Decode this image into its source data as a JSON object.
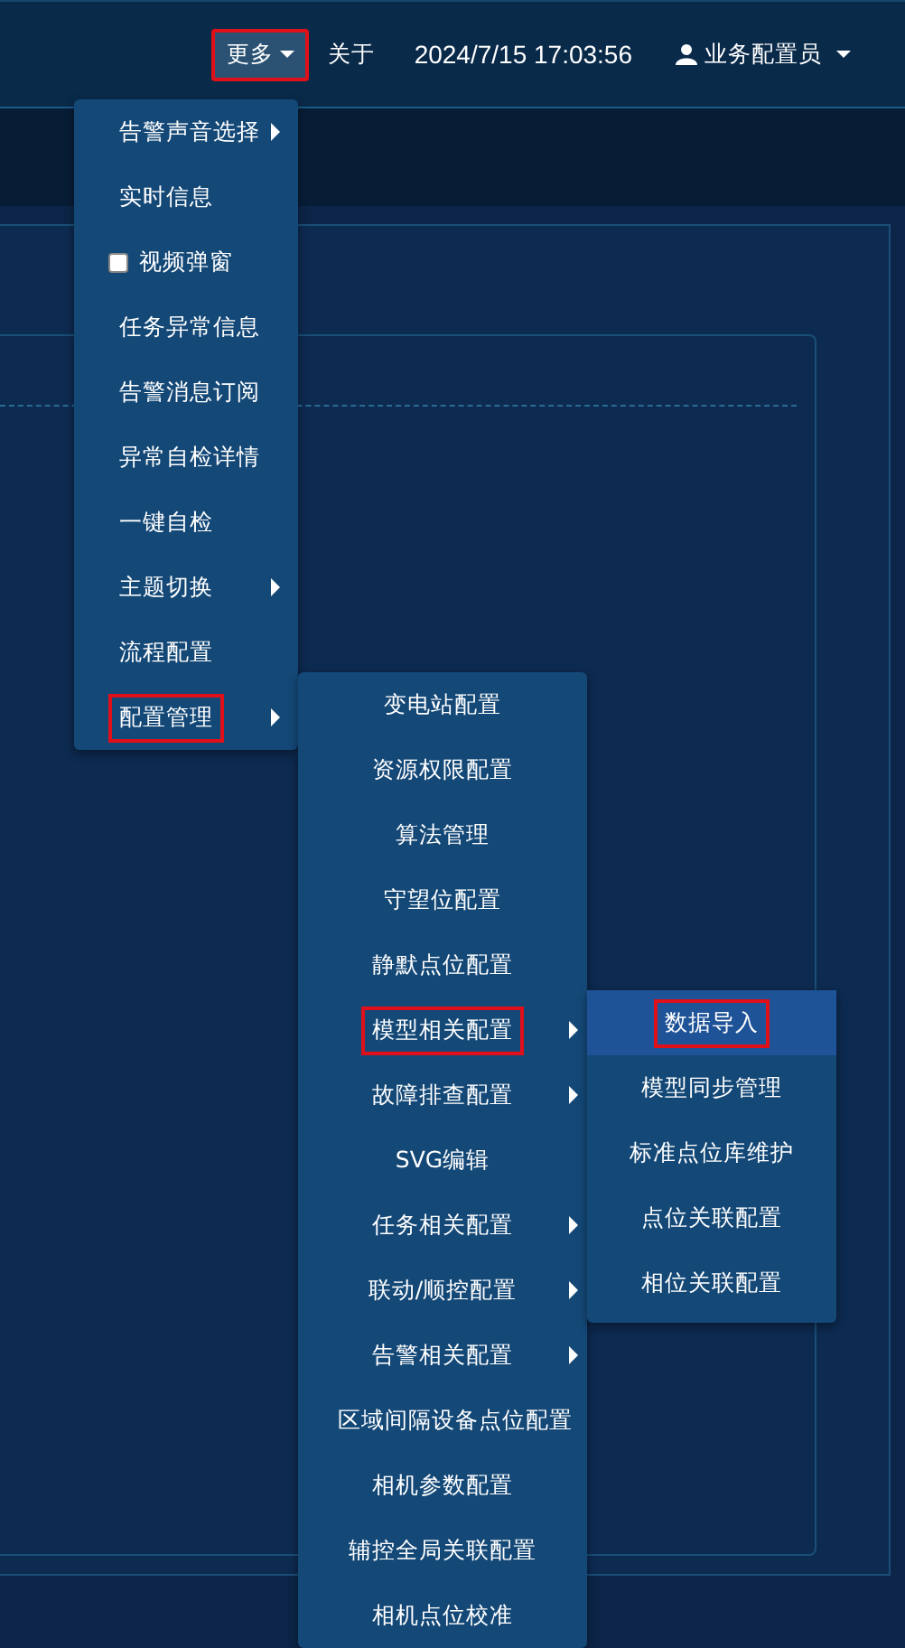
{
  "header": {
    "more_button": {
      "label": "更多",
      "marked": true
    },
    "about": "关于",
    "datetime": "2024/7/15 17:03:56",
    "user": "业务配置员"
  },
  "menu": [
    {
      "label": "告警声音选择",
      "kind": "submenu",
      "marked": false
    },
    {
      "label": "实时信息",
      "kind": "plain",
      "marked": false
    },
    {
      "label": "视频弹窗",
      "kind": "checkbox",
      "checked": false,
      "marked": false
    },
    {
      "label": "任务异常信息",
      "kind": "plain",
      "marked": false
    },
    {
      "label": "告警消息订阅",
      "kind": "plain",
      "marked": false
    },
    {
      "label": "异常自检详情",
      "kind": "plain",
      "marked": false
    },
    {
      "label": "一键自检",
      "kind": "plain",
      "marked": false
    },
    {
      "label": "主题切换",
      "kind": "submenu",
      "marked": false
    },
    {
      "label": "流程配置",
      "kind": "plain",
      "marked": false
    },
    {
      "label": "配置管理",
      "kind": "submenu",
      "marked": true
    }
  ],
  "submenu": [
    {
      "label": "变电站配置",
      "kind": "plain",
      "marked": false
    },
    {
      "label": "资源权限配置",
      "kind": "plain",
      "marked": false
    },
    {
      "label": "算法管理",
      "kind": "plain",
      "marked": false
    },
    {
      "label": "守望位配置",
      "kind": "plain",
      "marked": false
    },
    {
      "label": "静默点位配置",
      "kind": "plain",
      "marked": false
    },
    {
      "label": "模型相关配置",
      "kind": "submenu",
      "marked": true
    },
    {
      "label": "故障排查配置",
      "kind": "submenu",
      "marked": false
    },
    {
      "label": "SVG编辑",
      "kind": "plain",
      "marked": false
    },
    {
      "label": "任务相关配置",
      "kind": "submenu",
      "marked": false
    },
    {
      "label": "联动/顺控配置",
      "kind": "submenu",
      "marked": false
    },
    {
      "label": "告警相关配置",
      "kind": "submenu",
      "marked": false
    },
    {
      "label": "区域间隔设备点位配置",
      "kind": "plain",
      "marked": false
    },
    {
      "label": "相机参数配置",
      "kind": "plain",
      "marked": false
    },
    {
      "label": "辅控全局关联配置",
      "kind": "plain",
      "marked": false
    },
    {
      "label": "相机点位校准",
      "kind": "plain",
      "marked": false
    }
  ],
  "submenu2": [
    {
      "label": "数据导入",
      "selected": true,
      "marked": true
    },
    {
      "label": "模型同步管理",
      "selected": false,
      "marked": false
    },
    {
      "label": "标准点位库维护",
      "selected": false,
      "marked": false
    },
    {
      "label": "点位关联配置",
      "selected": false,
      "marked": false
    },
    {
      "label": "相位关联配置",
      "selected": false,
      "marked": false
    }
  ]
}
